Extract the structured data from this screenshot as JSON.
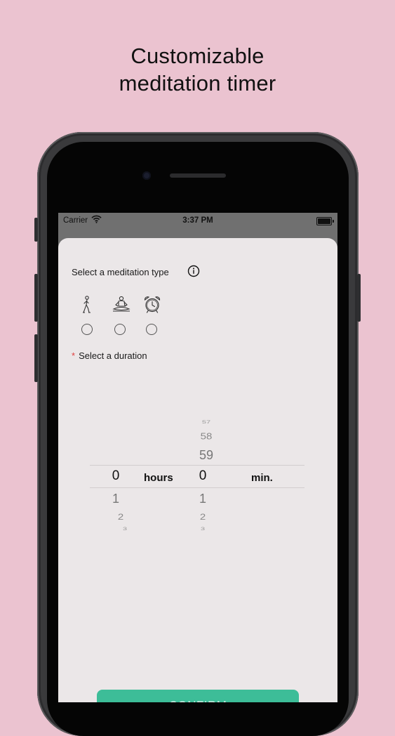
{
  "headline": {
    "line1": "Customizable",
    "line2": "meditation timer"
  },
  "status_bar": {
    "carrier": "Carrier",
    "time": "3:37 PM"
  },
  "sheet": {
    "type_label": "Select a meditation type",
    "types": [
      {
        "icon": "walking-person-icon",
        "selected": false
      },
      {
        "icon": "meditating-person-icon",
        "selected": false
      },
      {
        "icon": "alarm-clock-icon",
        "selected": false
      }
    ],
    "duration_asterisk": "*",
    "duration_label": "Select a duration",
    "picker": {
      "hours": {
        "above": [],
        "selected": "0",
        "below": [
          "1",
          "2",
          "3"
        ],
        "unit": "hours"
      },
      "minutes": {
        "above": [
          "57",
          "58",
          "59"
        ],
        "selected": "0",
        "below": [
          "1",
          "2",
          "3"
        ],
        "unit": "min."
      }
    },
    "confirm_label": "CONFIRM"
  },
  "colors": {
    "background": "#ebc3d0",
    "sheet": "#ebe7e8",
    "confirm": "#3dbd98",
    "asterisk": "#e04040"
  }
}
